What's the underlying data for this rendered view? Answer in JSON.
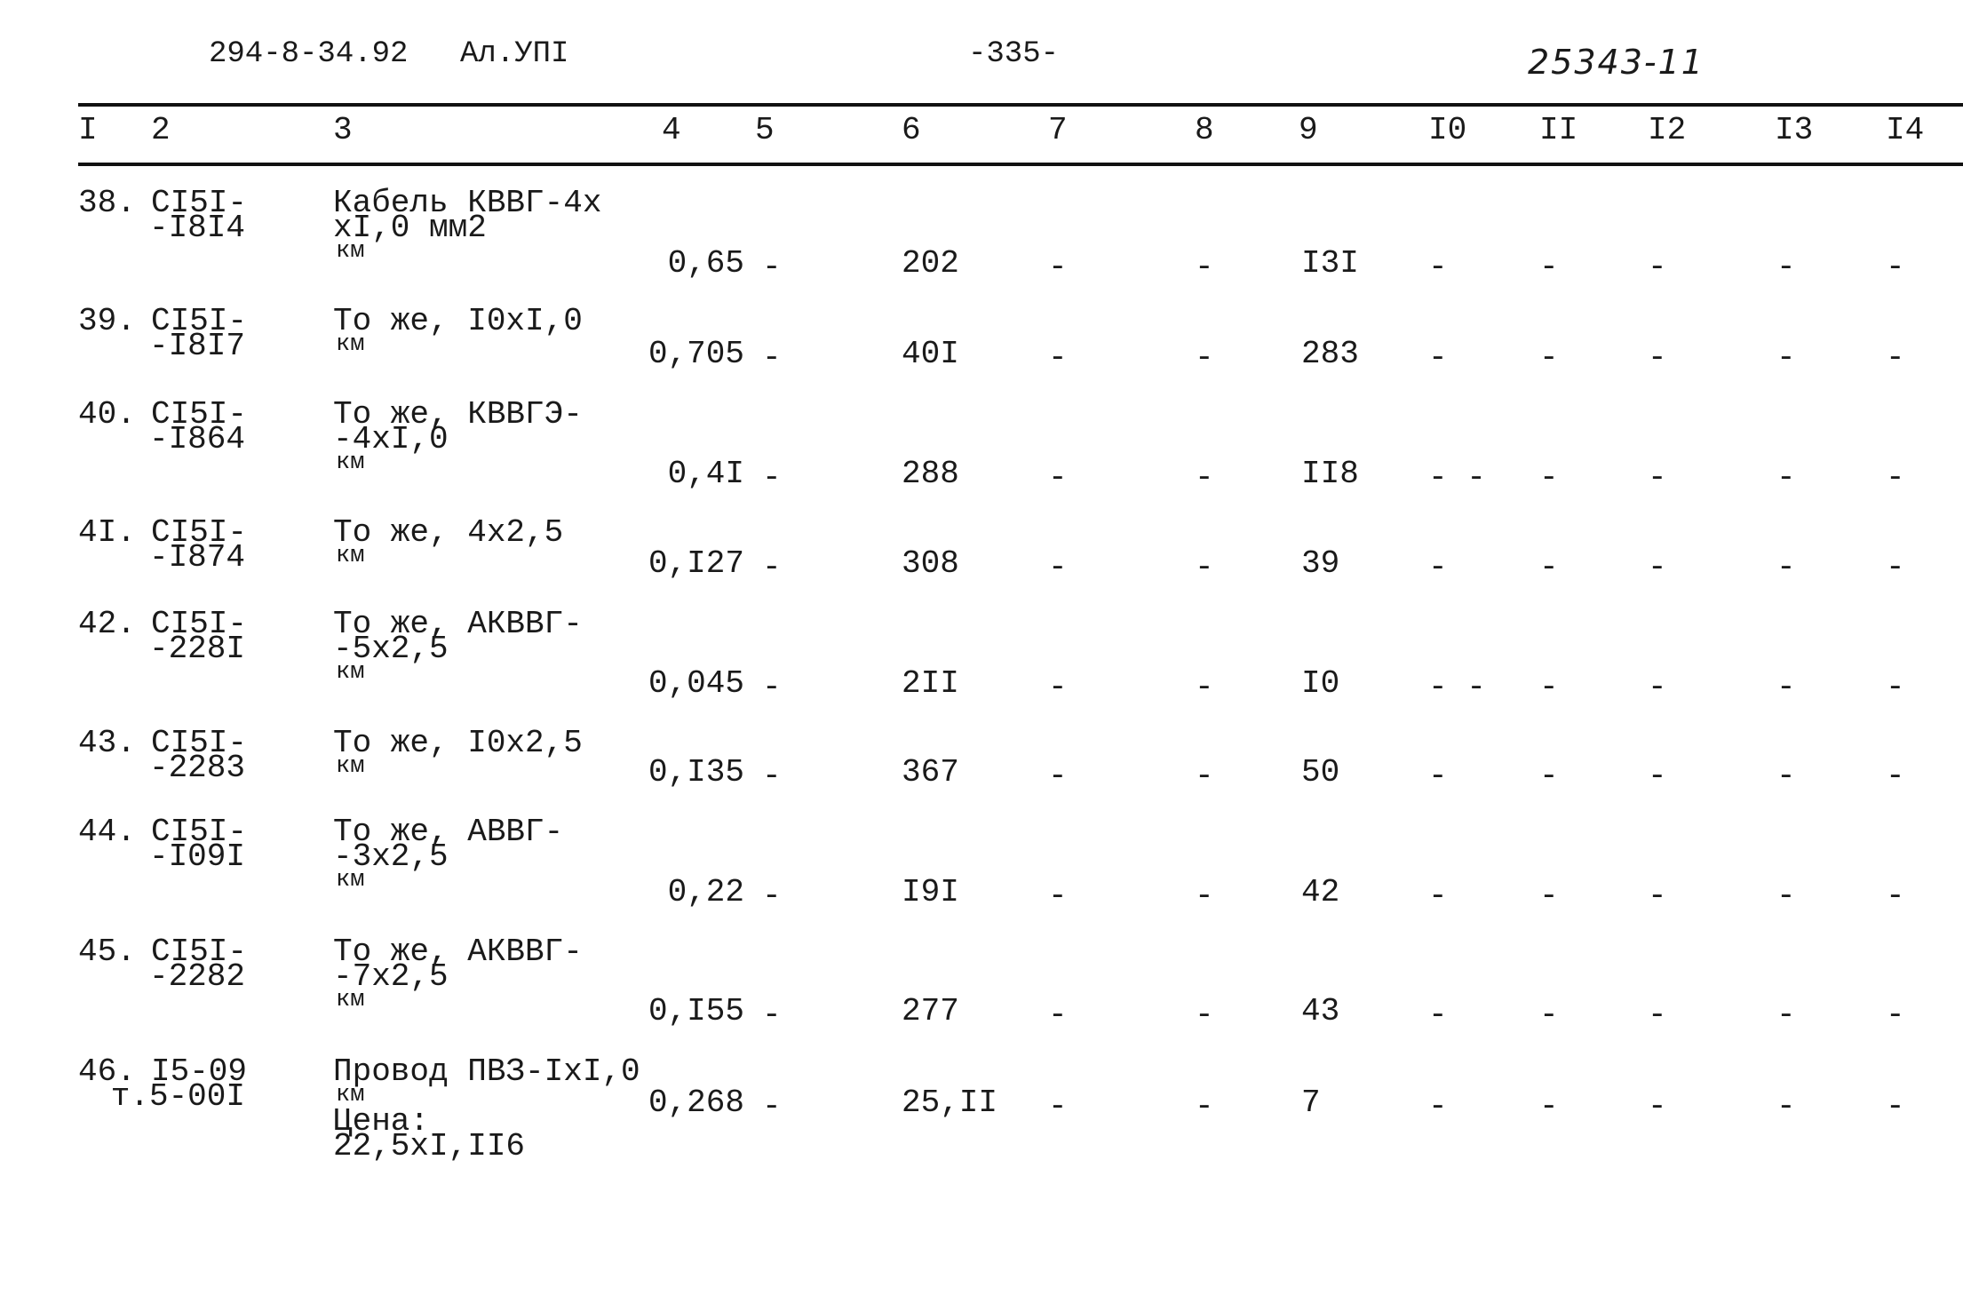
{
  "header": {
    "doc_code": "294-8-34.92",
    "album": "Ал.УПI",
    "page": "-335-",
    "sheet_number": "25343-11"
  },
  "columns": [
    "I",
    "2",
    "3",
    "4",
    "5",
    "6",
    "7",
    "8",
    "9",
    "I0",
    "II",
    "I2",
    "I3",
    "I4"
  ],
  "rows": [
    {
      "num": "38.",
      "code_l1": "CI5I-",
      "code_l2": "-I8I4",
      "desc": [
        "Кабель КВВГ-4х",
        "хI,0 мм2"
      ],
      "unit": "км",
      "extra": [],
      "c4": "0,65",
      "c5": "-",
      "c6": "202",
      "c7": "-",
      "c8": "-",
      "c9": "I3I",
      "c10": "-",
      "c11": "-",
      "c12": "-",
      "c13": "-",
      "c14": "-"
    },
    {
      "num": "39.",
      "code_l1": "CI5I-",
      "code_l2": "-I8I7",
      "desc": [
        "То же, I0хI,0"
      ],
      "unit": "км",
      "extra": [],
      "c4": "0,705",
      "c5": "-",
      "c6": "40I",
      "c7": "-",
      "c8": "-",
      "c9": "283",
      "c10": "-",
      "c11": "-",
      "c12": "-",
      "c13": "-",
      "c14": "-"
    },
    {
      "num": "40.",
      "code_l1": "CI5I-",
      "code_l2": "-I864",
      "desc": [
        "То же, КВВГЭ-",
        "-4хI,0"
      ],
      "unit": "км",
      "extra": [],
      "c4": "0,4I",
      "c5": "-",
      "c6": "288",
      "c7": "-",
      "c8": "-",
      "c9": "II8",
      "c10": "- -",
      "c11": "-",
      "c12": "-",
      "c13": "-",
      "c14": "-"
    },
    {
      "num": "4I.",
      "code_l1": "CI5I-",
      "code_l2": "-I874",
      "desc": [
        "То же, 4х2,5"
      ],
      "unit": "км",
      "extra": [],
      "c4": "0,I27",
      "c5": "-",
      "c6": "308",
      "c7": "-",
      "c8": "-",
      "c9": "39",
      "c10": "-",
      "c11": "-",
      "c12": "-",
      "c13": "-",
      "c14": "-"
    },
    {
      "num": "42.",
      "code_l1": "CI5I-",
      "code_l2": "-228I",
      "desc": [
        "То же, АКВВГ-",
        "-5х2,5"
      ],
      "unit": "км",
      "extra": [],
      "c4": "0,045",
      "c5": "-",
      "c6": "2II",
      "c7": "-",
      "c8": "-",
      "c9": "I0",
      "c10": "- -",
      "c11": "-",
      "c12": "-",
      "c13": "-",
      "c14": "-"
    },
    {
      "num": "43.",
      "code_l1": "CI5I-",
      "code_l2": "-2283",
      "desc": [
        "То же, I0х2,5"
      ],
      "unit": "км",
      "extra": [],
      "c4": "0,I35",
      "c5": "-",
      "c6": "367",
      "c7": "-",
      "c8": "-",
      "c9": "50",
      "c10": "-",
      "c11": "-",
      "c12": "-",
      "c13": "-",
      "c14": "-"
    },
    {
      "num": "44.",
      "code_l1": "CI5I-",
      "code_l2": "-I09I",
      "desc": [
        "То же, АВВГ-",
        "-3х2,5"
      ],
      "unit": "км",
      "extra": [],
      "c4": "0,22",
      "c5": "-",
      "c6": "I9I",
      "c7": "-",
      "c8": "-",
      "c9": "42",
      "c10": "-",
      "c11": "-",
      "c12": "-",
      "c13": "-",
      "c14": "-"
    },
    {
      "num": "45.",
      "code_l1": "CI5I-",
      "code_l2": "-2282",
      "desc": [
        "То же, АКВВГ-",
        "-7х2,5"
      ],
      "unit": "км",
      "extra": [],
      "c4": "0,I55",
      "c5": "-",
      "c6": "277",
      "c7": "-",
      "c8": "-",
      "c9": "43",
      "c10": "-",
      "c11": "-",
      "c12": "-",
      "c13": "-",
      "c14": "-"
    },
    {
      "num": "46.",
      "code_l1": "I5-09",
      "code_l2": "т.5-00I",
      "desc": [
        "Провод ПВЗ-IхI,0"
      ],
      "unit": "км",
      "extra": [
        "Цена:",
        "22,5хI,II6"
      ],
      "c4": "0,268",
      "c5": "-",
      "c6": "25,II",
      "c7": "-",
      "c8": "-",
      "c9": "7",
      "c10": "-",
      "c11": "-",
      "c12": "-",
      "c13": "-",
      "c14": "-"
    }
  ]
}
